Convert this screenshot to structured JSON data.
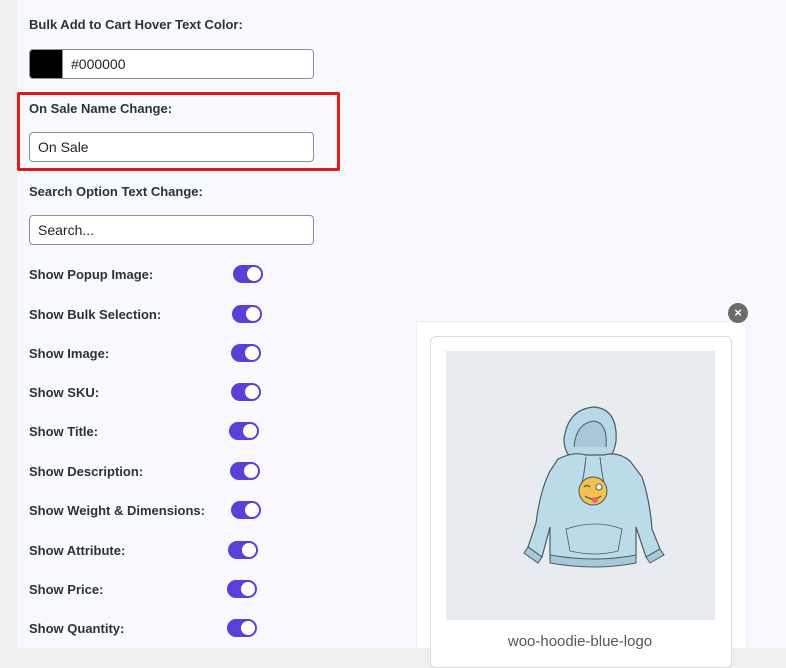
{
  "settings": {
    "hover_color_label": "Bulk Add to Cart Hover Text Color:",
    "hover_color_value": "#000000",
    "hover_color_swatch": "#000000",
    "on_sale_label": "On Sale Name Change:",
    "on_sale_value": "On Sale",
    "search_label": "Search Option Text Change:",
    "search_value": "Search..."
  },
  "toggles": [
    {
      "label": "Show Popup Image:",
      "on": true
    },
    {
      "label": "Show Bulk Selection:",
      "on": true
    },
    {
      "label": "Show Image:",
      "on": true
    },
    {
      "label": "Show SKU:",
      "on": true
    },
    {
      "label": "Show Title:",
      "on": true
    },
    {
      "label": "Show Description:",
      "on": true
    },
    {
      "label": "Show Weight & Dimensions:",
      "on": true
    },
    {
      "label": "Show Attribute:",
      "on": true
    },
    {
      "label": "Show Price:",
      "on": true
    },
    {
      "label": "Show Quantity:",
      "on": true
    }
  ],
  "popup": {
    "close_icon": "×",
    "product_name": "woo-hoodie-blue-logo"
  },
  "colors": {
    "accent": "#5b3fd6",
    "highlight": "#e11a1a"
  }
}
